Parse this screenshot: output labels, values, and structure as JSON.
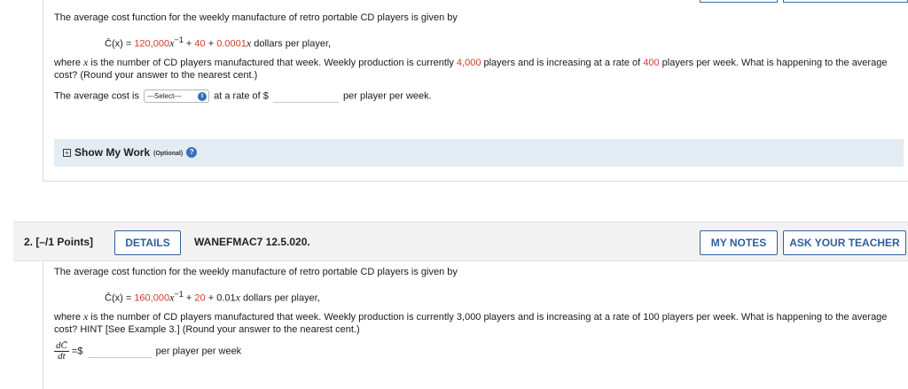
{
  "q1": {
    "intro": "The average cost function for the weekly manufacture of retro portable CD players is given by",
    "formula": {
      "lhs": "C̄(x) = ",
      "t1_coef": "120,000",
      "t1_var": "x",
      "t1_exp": "−1",
      "plus1": " + ",
      "t2": "40",
      "plus2": " + ",
      "t3_coef": "0.0001",
      "t3_var": "x",
      "unit": " dollars per player,"
    },
    "body": {
      "part1": "where ",
      "var": "x",
      "part2": " is the number of CD players manufactured that week. Weekly production is currently ",
      "production": "4,000",
      "part3": " players and is increasing at a rate of ",
      "rate": "400",
      "part4": " players per week. What is happening to the average cost? (Round your answer to the nearest cent.)"
    },
    "answer": {
      "lead": "The average cost is",
      "select_value": "---Select---",
      "mid": "at a rate of $",
      "tail": "per player per week."
    },
    "show_work": {
      "label": "Show My Work",
      "optional": "(Optional)",
      "help_glyph": "?"
    }
  },
  "q2": {
    "header": {
      "title": "2.  [–/1 Points]",
      "details_label": "DETAILS",
      "code": "WANEFMAC7 12.5.020.",
      "my_notes_label": "MY NOTES",
      "ask_teacher_label": "ASK YOUR TEACHER"
    },
    "intro": "The average cost function for the weekly manufacture of retro portable CD players is given by",
    "formula": {
      "lhs": "C̄(x) = ",
      "t1_coef": "160,000",
      "t1_var": "x",
      "t1_exp": "−1",
      "plus1": " + ",
      "t2": "20",
      "plus2": " + ",
      "t3_coef": "0.01",
      "t3_var": "x",
      "unit": " dollars per player,"
    },
    "body": {
      "part1": "where ",
      "var": "x",
      "part2": " is the number of CD players manufactured that week. Weekly production is currently 3,000 players and is increasing at a rate of 100 players per week. What is happening to the average cost? HINT [See Example 3.] (Round your answer to the nearest cent.)"
    },
    "answer": {
      "frac_num": "dC̄",
      "frac_den": "dt",
      "equals": "=$",
      "tail": "per player per week"
    }
  },
  "colors": {
    "accent_red": "#d13b2a",
    "button_blue": "#2f5f9a",
    "show_work_bg": "#e3ebf3"
  }
}
